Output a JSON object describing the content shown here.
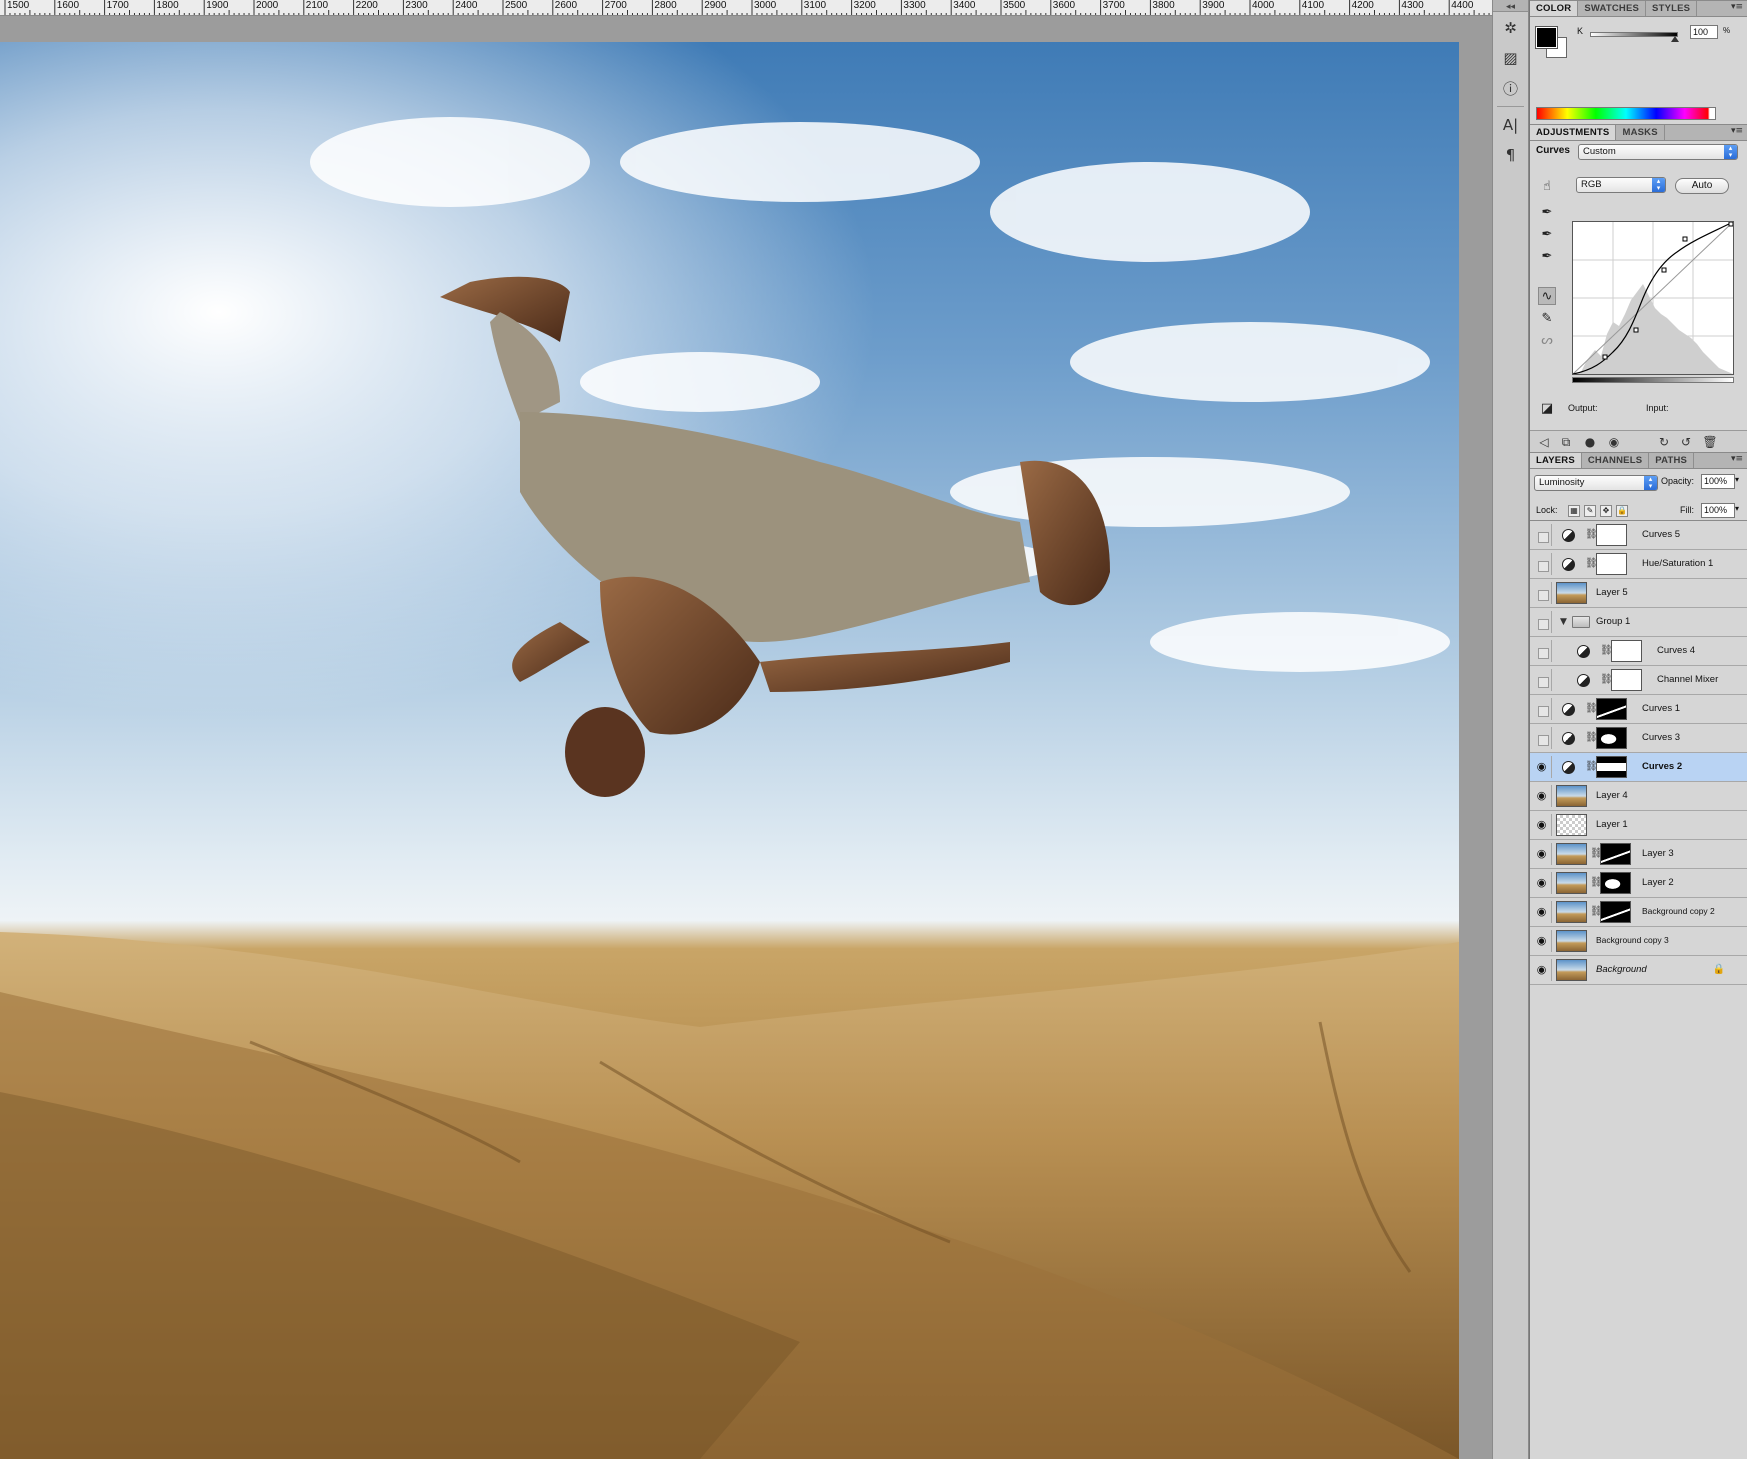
{
  "ruler": {
    "labels": [
      "1500",
      "1600",
      "1700",
      "1800",
      "1900",
      "2000",
      "2100",
      "2200",
      "2300",
      "2400",
      "2500",
      "2600",
      "2700",
      "2800",
      "2900",
      "3000",
      "3100",
      "3200",
      "3300",
      "3400",
      "3500",
      "3600",
      "3700",
      "3800",
      "3900",
      "4000",
      "4100",
      "4200",
      "4300",
      "4400"
    ]
  },
  "canvas": {
    "description_image": "backflip-desert-photo"
  },
  "dock": {
    "collapse_glyph": "◂◂",
    "icons": [
      "navigator-icon",
      "histogram-icon",
      "info-icon",
      "character-icon",
      "paragraph-icon"
    ]
  },
  "color_panel": {
    "tabs": [
      "COLOR",
      "SWATCHES",
      "STYLES"
    ],
    "channel_label": "K",
    "k_value": "100",
    "k_unit": "%",
    "menu_glyph": "▾≡"
  },
  "adjustments_panel": {
    "tabs": [
      "ADJUSTMENTS",
      "MASKS"
    ],
    "title": "Curves",
    "preset": "Custom",
    "channel": "RGB",
    "auto_label": "Auto",
    "output_label": "Output:",
    "input_label": "Input:"
  },
  "layers_panel": {
    "tabs": [
      "LAYERS",
      "CHANNELS",
      "PATHS"
    ],
    "blend_mode": "Luminosity",
    "opacity_label": "Opacity:",
    "opacity_value": "100%",
    "lock_label": "Lock:",
    "fill_label": "Fill:",
    "fill_value": "100%",
    "layers": [
      {
        "name": "Curves 5",
        "visible": false,
        "type": "adjustment",
        "mask": "white",
        "indent": 0
      },
      {
        "name": "Hue/Saturation 1",
        "visible": false,
        "type": "adjustment",
        "mask": "white",
        "indent": 0
      },
      {
        "name": "Layer 5",
        "visible": false,
        "type": "pixel",
        "thumb": "photo",
        "indent": 0
      },
      {
        "name": "Group 1",
        "visible": false,
        "type": "group",
        "indent": 0
      },
      {
        "name": "Curves 4",
        "visible": false,
        "type": "adjustment",
        "mask": "white",
        "indent": 1
      },
      {
        "name": "Channel Mixer",
        "visible": false,
        "type": "adjustment",
        "mask": "cm",
        "indent": 1
      },
      {
        "name": "Curves 1",
        "visible": false,
        "type": "adjustment",
        "mask": "mask1",
        "indent": 0
      },
      {
        "name": "Curves 3",
        "visible": false,
        "type": "adjustment",
        "mask": "mask2",
        "indent": 0
      },
      {
        "name": "Curves 2",
        "visible": true,
        "type": "adjustment",
        "mask": "mask3",
        "indent": 0,
        "selected": true
      },
      {
        "name": "Layer 4",
        "visible": true,
        "type": "pixel",
        "thumb": "photo",
        "indent": 0
      },
      {
        "name": "Layer 1",
        "visible": true,
        "type": "pixel",
        "thumb": "trans",
        "indent": 0
      },
      {
        "name": "Layer 3",
        "visible": true,
        "type": "pixel-mask",
        "thumb": "photo",
        "mask": "mask1",
        "indent": 0
      },
      {
        "name": "Layer 2",
        "visible": true,
        "type": "pixel-mask",
        "thumb": "photo",
        "mask": "mask2",
        "indent": 0
      },
      {
        "name": "Background copy 2",
        "visible": true,
        "type": "pixel-mask",
        "thumb": "photo",
        "mask": "mask1",
        "indent": 0
      },
      {
        "name": "Background copy 3",
        "visible": true,
        "type": "pixel",
        "thumb": "photo",
        "indent": 0
      },
      {
        "name": "Background",
        "visible": true,
        "type": "pixel",
        "thumb": "photo",
        "indent": 0,
        "locked": true,
        "italic": true
      }
    ]
  }
}
